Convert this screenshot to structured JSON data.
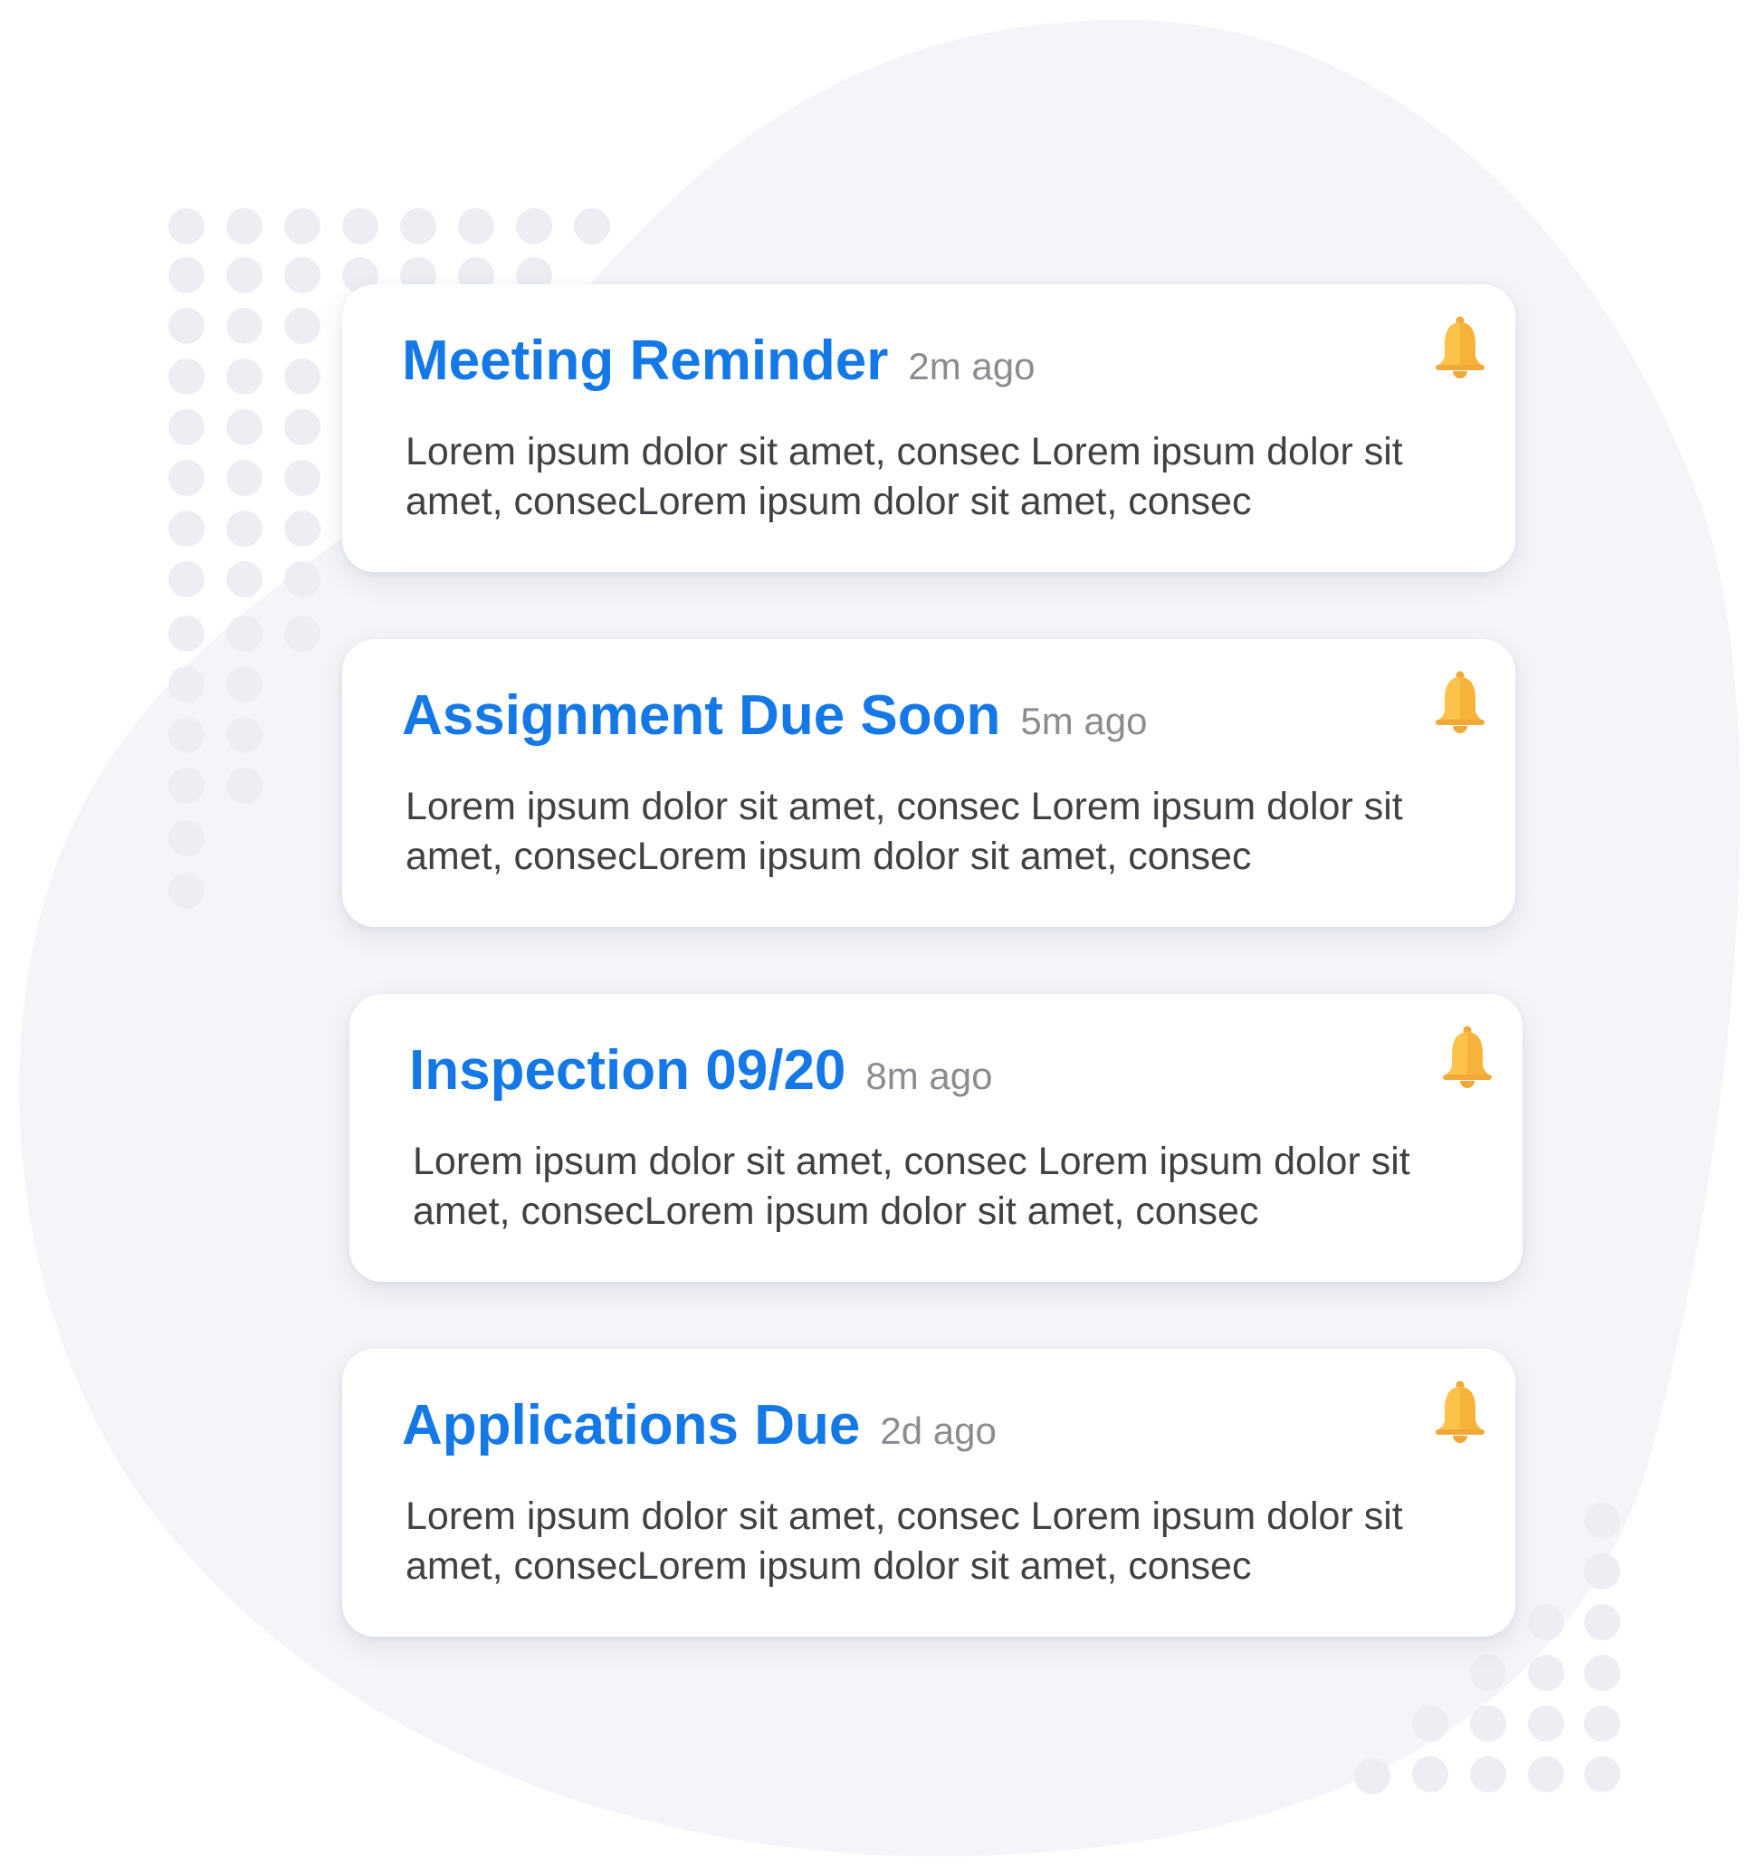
{
  "colors": {
    "accent": "#1478e6",
    "timestamp": "#8a8c90",
    "body_text": "#404145",
    "bell": "#fcc24a",
    "background_blob": "#f4f5f8"
  },
  "notifications": [
    {
      "title": "Meeting Reminder",
      "time": "2m ago",
      "body": "Lorem ipsum dolor sit amet, consec Lorem ipsum dolor sit amet, consecLorem ipsum dolor sit amet, consec",
      "icon": "bell-icon"
    },
    {
      "title": "Assignment Due Soon",
      "time": "5m ago",
      "body": "Lorem ipsum dolor sit amet, consec Lorem ipsum dolor sit amet, consecLorem ipsum dolor sit amet, consec",
      "icon": "bell-icon"
    },
    {
      "title": "Inspection 09/20",
      "time": "8m ago",
      "body": "Lorem ipsum dolor sit amet, consec Lorem ipsum dolor sit amet, consecLorem ipsum dolor sit amet, consec",
      "icon": "bell-icon"
    },
    {
      "title": "Applications Due",
      "time": "2d ago",
      "body": "Lorem ipsum dolor sit amet, consec Lorem ipsum dolor sit amet, consecLorem ipsum dolor sit amet, consec",
      "icon": "bell-icon"
    }
  ]
}
